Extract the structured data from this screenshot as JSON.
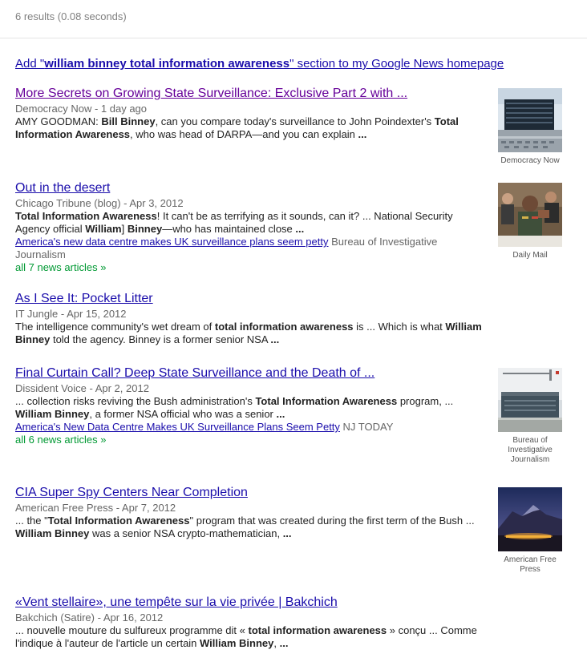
{
  "stats": "6 results (0.08 seconds)",
  "add_section": {
    "prefix": "Add \"",
    "query": "william binney total information awareness",
    "suffix": "\" section to my Google News homepage"
  },
  "results": [
    {
      "title": "More Secrets on Growing State Surveillance: Exclusive Part 2 with ...",
      "meta": "Democracy Now - 1 day ago",
      "snippet": [
        {
          "t": "AMY GOODMAN: ",
          "b": false
        },
        {
          "t": "Bill Binney",
          "b": true
        },
        {
          "t": ", can you compare today's surveillance to John Poindexter's ",
          "b": false
        },
        {
          "t": "Total Information Awareness",
          "b": true
        },
        {
          "t": ", who was head of DARPA—and you can explain ",
          "b": false
        },
        {
          "t": "...",
          "b": true
        }
      ],
      "thumb": {
        "source": "Democracy Now",
        "icon": "nsa-building-photo"
      }
    },
    {
      "title": "Out in the desert",
      "meta": "Chicago Tribune (blog) - Apr 3, 2012",
      "snippet": [
        {
          "t": "Total Information Awareness",
          "b": true
        },
        {
          "t": "! It can't be as terrifying as it sounds, can it? ... National Security Agency official ",
          "b": false
        },
        {
          "t": "William",
          "b": true
        },
        {
          "t": "] ",
          "b": false
        },
        {
          "t": "Binney",
          "b": true
        },
        {
          "t": "—who has maintained close ",
          "b": false
        },
        {
          "t": "...",
          "b": true
        }
      ],
      "related": {
        "link": "America's new data centre makes UK surveillance plans seem petty",
        "source": " Bureau of Investigative Journalism"
      },
      "all_articles": "all 7 news articles »",
      "thumb": {
        "source": "Daily Mail",
        "icon": "general-testimony-photo"
      }
    },
    {
      "title": "As I See It: Pocket Litter",
      "meta": "IT Jungle - Apr 15, 2012",
      "snippet": [
        {
          "t": "The intelligence community's wet dream of ",
          "b": false
        },
        {
          "t": "total information awareness",
          "b": true
        },
        {
          "t": " is ... Which is what ",
          "b": false
        },
        {
          "t": "William Binney",
          "b": true
        },
        {
          "t": " told the agency. Binney is a former senior NSA ",
          "b": false
        },
        {
          "t": "...",
          "b": true
        }
      ]
    },
    {
      "title": "Final Curtain Call? Deep State Surveillance and the Death of ...",
      "meta": "Dissident Voice - Apr 2, 2012",
      "snippet": [
        {
          "t": "... collection risks reviving the Bush administration's ",
          "b": false
        },
        {
          "t": "Total Information Awareness",
          "b": true
        },
        {
          "t": " program, ... ",
          "b": false
        },
        {
          "t": "William Binney",
          "b": true
        },
        {
          "t": ", a former NSA official who was a senior ",
          "b": false
        },
        {
          "t": "...",
          "b": true
        }
      ],
      "related": {
        "link": "America's New Data Centre Makes UK Surveillance Plans Seem Petty",
        "source": " NJ TODAY"
      },
      "all_articles": "all 6 news articles »",
      "thumb": {
        "source": "Bureau of Investigative Journalism",
        "icon": "data-center-photo"
      }
    },
    {
      "title": "CIA Super Spy Centers Near Completion",
      "meta": "American Free Press - Apr 7, 2012",
      "snippet": [
        {
          "t": "... the \"",
          "b": false
        },
        {
          "t": "Total Information Awareness",
          "b": true
        },
        {
          "t": "\" program that was created during the first term of the Bush ... ",
          "b": false
        },
        {
          "t": "William Binney",
          "b": true
        },
        {
          "t": " was a senior NSA crypto-mathematician, ",
          "b": false
        },
        {
          "t": "...",
          "b": true
        }
      ],
      "thumb": {
        "source": "American Free Press",
        "icon": "mountain-night-photo"
      }
    },
    {
      "title": "«Vent stellaire», une tempête sur la vie privée | Bakchich",
      "meta": "Bakchich (Satire) - Apr 16, 2012",
      "snippet": [
        {
          "t": "... nouvelle mouture du sulfureux programme dit « ",
          "b": false
        },
        {
          "t": "total information awareness",
          "b": true
        },
        {
          "t": " » conçu ... Comme l'indique à l'auteur de l'article un certain ",
          "b": false
        },
        {
          "t": "William Binney",
          "b": true
        },
        {
          "t": ", ",
          "b": false
        },
        {
          "t": "...",
          "b": true
        }
      ]
    }
  ]
}
